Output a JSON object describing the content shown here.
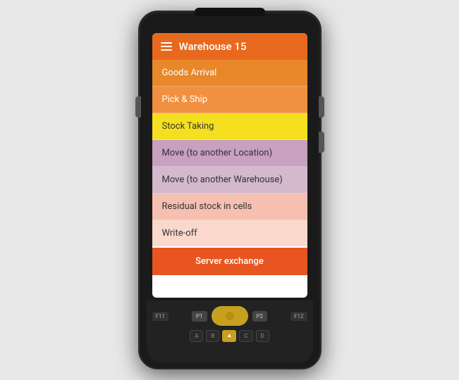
{
  "device": {
    "header": {
      "title": "Warehouse 15",
      "menu_icon": "hamburger-icon"
    },
    "menu_items": [
      {
        "id": 1,
        "label": "Goods Arrival",
        "color_class": "menu-item-1"
      },
      {
        "id": 2,
        "label": "Pick & Ship",
        "color_class": "menu-item-2"
      },
      {
        "id": 3,
        "label": "Stock Taking",
        "color_class": "menu-item-3"
      },
      {
        "id": 4,
        "label": "Move (to another Location)",
        "color_class": "menu-item-4"
      },
      {
        "id": 5,
        "label": "Move (to another Warehouse)",
        "color_class": "menu-item-5"
      },
      {
        "id": 6,
        "label": "Residual stock in cells",
        "color_class": "menu-item-6"
      },
      {
        "id": 7,
        "label": "Write-off",
        "color_class": "menu-item-7"
      }
    ],
    "server_exchange_button": "Server exchange",
    "keypad": {
      "fn_keys": [
        "F11",
        "F12"
      ],
      "p_keys": [
        "P1",
        "P2"
      ],
      "alpha_keys": [
        "A",
        "B",
        "C",
        "D"
      ]
    }
  }
}
